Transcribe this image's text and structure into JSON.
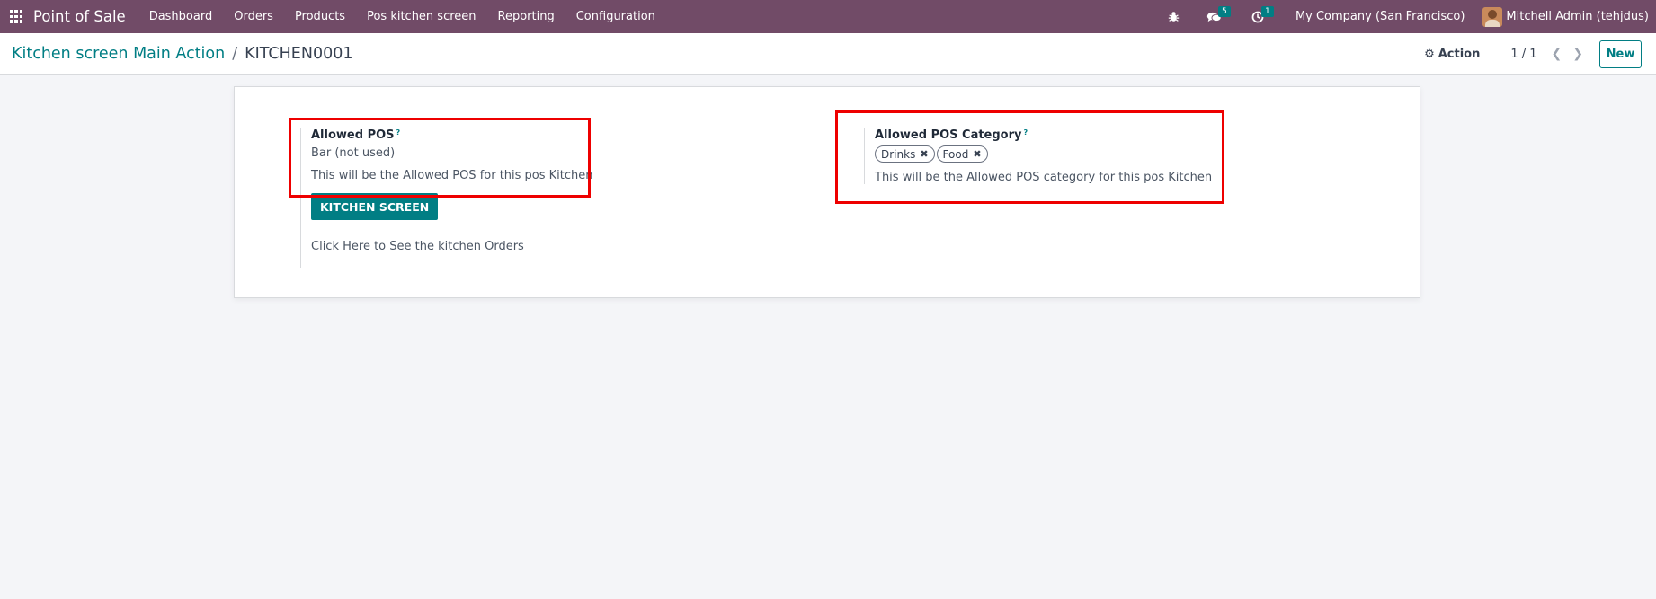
{
  "navbar": {
    "app_name": "Point of Sale",
    "menu": [
      "Dashboard",
      "Orders",
      "Products",
      "Pos kitchen screen",
      "Reporting",
      "Configuration"
    ],
    "icons": {
      "apps": "apps-grid-icon",
      "debug": "bug-icon",
      "messages": "chat-icon",
      "activities": "clock-icon"
    },
    "messages_badge": "5",
    "activities_badge": "1",
    "company": "My Company (San Francisco)",
    "user": "Mitchell Admin (tehjdus)"
  },
  "control_panel": {
    "breadcrumb_parent": "Kitchen screen Main Action",
    "breadcrumb_sep": "/",
    "breadcrumb_current": "KITCHEN0001",
    "action_label": "Action",
    "pager": "1 / 1",
    "new_label": "New"
  },
  "form": {
    "allowed_pos": {
      "label": "Allowed POS",
      "help_mark": "?",
      "value": "Bar (not used)",
      "help": "This will be the Allowed POS for this pos Kitchen"
    },
    "allowed_pos_category": {
      "label": "Allowed POS Category",
      "help_mark": "?",
      "tags": [
        "Drinks",
        "Food"
      ],
      "help": "This will be the Allowed POS category for this pos Kitchen"
    },
    "kitchen_button": "KITCHEN SCREEN",
    "kitchen_note": "Click Here to See the kitchen Orders"
  },
  "colors": {
    "navbar": "#714b67",
    "accent": "#017e84",
    "highlight": "#ee0000"
  }
}
